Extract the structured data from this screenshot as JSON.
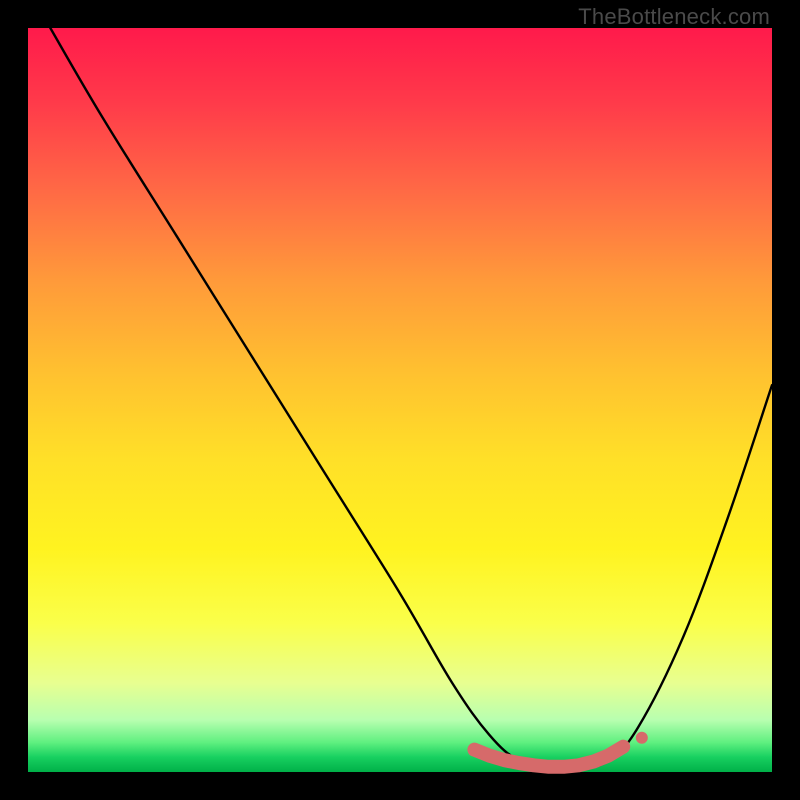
{
  "watermark": "TheBottleneck.com",
  "colors": {
    "frame_bg": "#000000",
    "curve_stroke": "#000000",
    "marker_fill": "#d66a6a",
    "marker_stroke": "#b85050"
  },
  "chart_data": {
    "type": "line",
    "title": "",
    "xlabel": "",
    "ylabel": "",
    "xlim": [
      0,
      100
    ],
    "ylim": [
      0,
      100
    ],
    "grid": false,
    "legend": false,
    "series": [
      {
        "name": "bottleneck-curve",
        "x": [
          3,
          10,
          20,
          30,
          40,
          50,
          57,
          62,
          66,
          70,
          74,
          78,
          82,
          88,
          94,
          100
        ],
        "y": [
          100,
          88,
          72,
          56,
          40,
          24,
          12,
          5,
          1.5,
          0.5,
          0.5,
          1.5,
          6,
          18,
          34,
          52
        ]
      }
    ],
    "markers": {
      "name": "highlight-range",
      "x": [
        60,
        62,
        64,
        66,
        68,
        70,
        72,
        74,
        76,
        78,
        80
      ],
      "y": [
        3.0,
        2.2,
        1.6,
        1.2,
        0.9,
        0.7,
        0.7,
        0.9,
        1.4,
        2.2,
        3.4
      ]
    }
  }
}
